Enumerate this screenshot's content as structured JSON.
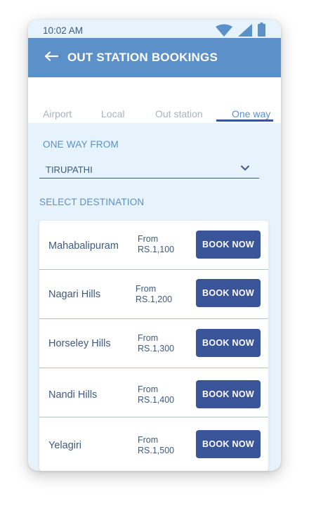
{
  "status_bar": {
    "time": "10:02 AM",
    "icons": [
      "wifi-icon",
      "signal-icon",
      "battery-icon"
    ]
  },
  "app_bar": {
    "title": "OUT STATION BOOKINGS",
    "back_icon": "back-arrow-icon"
  },
  "tabs": [
    {
      "label": "Airport",
      "active": false
    },
    {
      "label": "Local",
      "active": false
    },
    {
      "label": "Out station",
      "active": false
    },
    {
      "label": "One way",
      "active": true
    }
  ],
  "from": {
    "label": "ONE WAY FROM",
    "value": "TIRUPATHI",
    "icon": "chevron-down-icon"
  },
  "destinations": {
    "label": "SELECT DESTINATION",
    "items": [
      {
        "name": "Mahabalipuram",
        "from_label": "From",
        "price": "RS.1,100",
        "button": "BOOK NOW"
      },
      {
        "name": "Nagari Hills",
        "from_label": "From",
        "price": "RS.1,200",
        "button": "BOOK NOW"
      },
      {
        "name": "Horseley Hills",
        "from_label": "From",
        "price": "RS.1,300",
        "button": "BOOK NOW"
      },
      {
        "name": "Nandi Hills",
        "from_label": "From",
        "price": "RS.1,400",
        "button": "BOOK NOW"
      },
      {
        "name": "Yelagiri",
        "from_label": "From",
        "price": "RS.1,500",
        "button": "BOOK NOW"
      }
    ]
  },
  "colors": {
    "app_bar": "#5b90c8",
    "background": "#e6f2fc",
    "primary_button": "#3a5499",
    "text": "#3d5a80",
    "tab_inactive": "#a9b2bd"
  }
}
